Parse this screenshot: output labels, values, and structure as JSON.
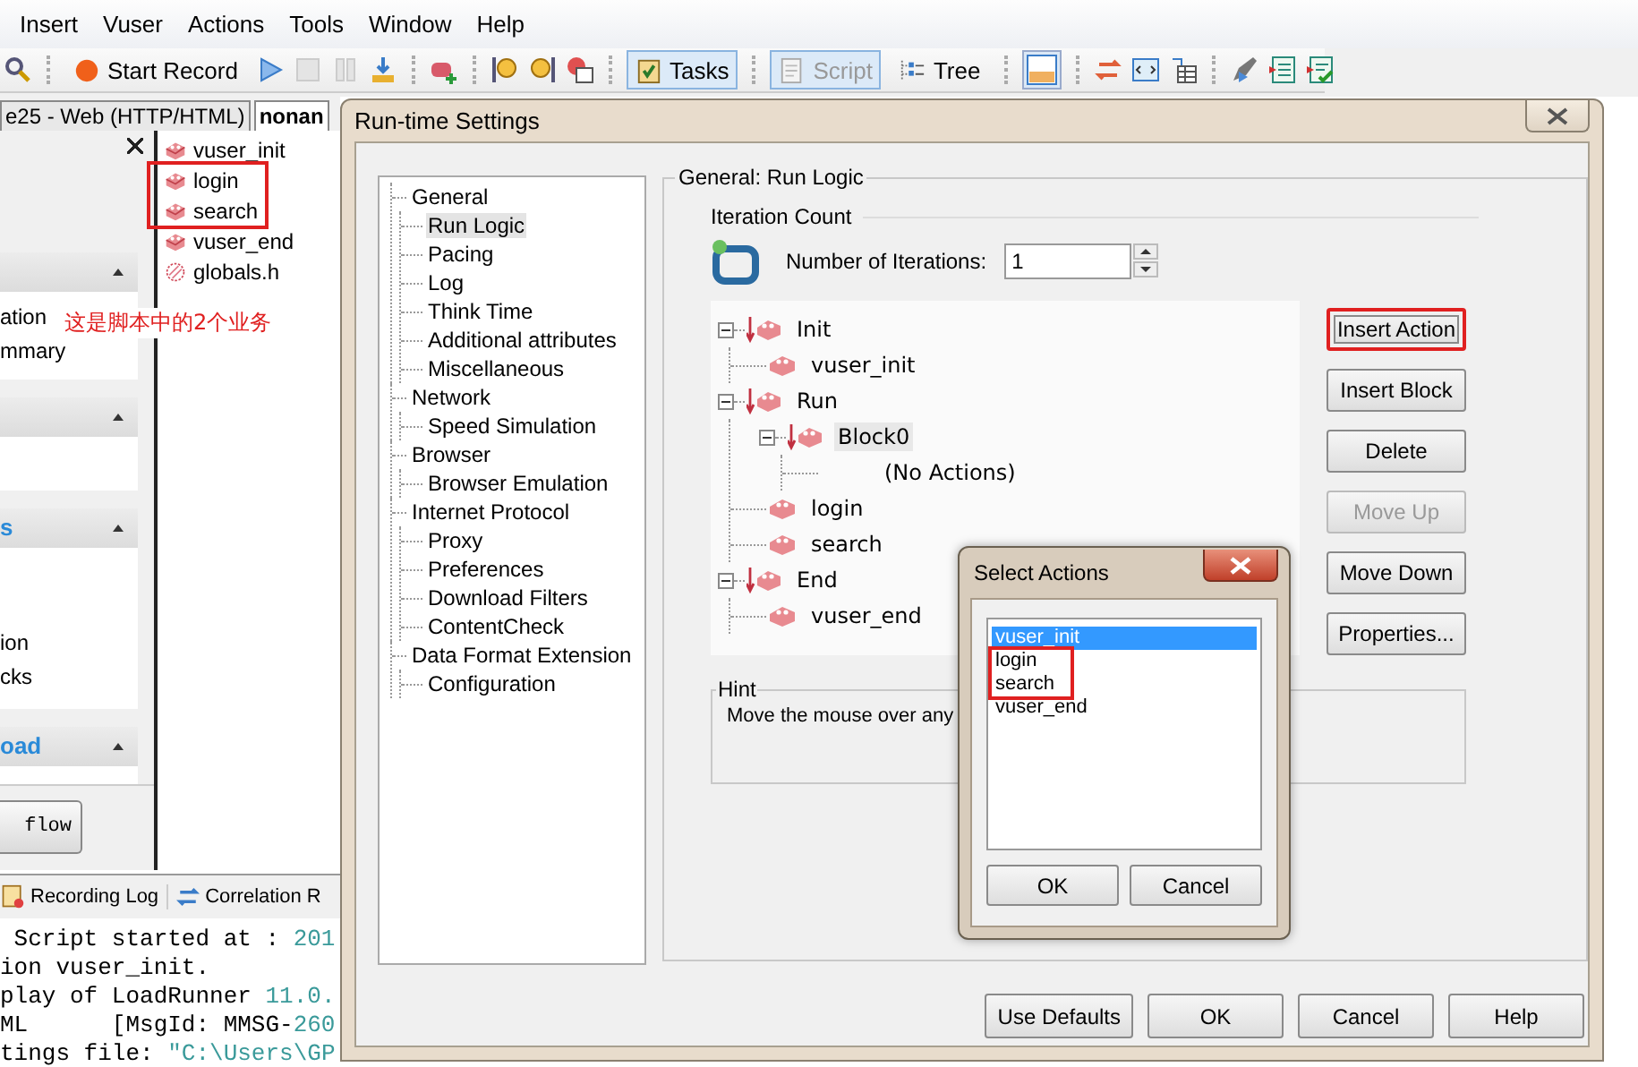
{
  "menu": [
    "Insert",
    "Vuser",
    "Actions",
    "Tools",
    "Window",
    "Help"
  ],
  "toolbar_buttons": [
    {
      "label": "Start Record",
      "selected": false,
      "disabled": false
    },
    {
      "label": "Tasks",
      "selected": true,
      "disabled": false
    },
    {
      "label": "Script",
      "selected": true,
      "disabled": true
    },
    {
      "label": "Tree",
      "selected": false,
      "disabled": false
    }
  ],
  "doc_tabs": [
    {
      "label": "e25 - Web (HTTP/HTML)",
      "selected": false
    },
    {
      "label": "nonan",
      "selected": true
    }
  ],
  "left_panel": {
    "sections": [
      {
        "expanded": true,
        "items": [
          "ation",
          "mmary"
        ]
      },
      {
        "expanded": true
      },
      {
        "title": "s",
        "expanded": true,
        "items": [
          "ion",
          "cks"
        ]
      },
      {
        "title": "oad",
        "expanded": true
      }
    ],
    "button": "flow"
  },
  "annotation_note": "这是脚本中的2个业务",
  "files": [
    {
      "name": "vuser_init",
      "kind": "action",
      "marked": false
    },
    {
      "name": "login",
      "kind": "action",
      "marked": true
    },
    {
      "name": "search",
      "kind": "action",
      "marked": true
    },
    {
      "name": "vuser_end",
      "kind": "action",
      "marked": false
    },
    {
      "name": "globals.h",
      "kind": "header",
      "marked": false
    }
  ],
  "output_tabs": [
    "Recording Log",
    "Correlation R"
  ],
  "log_lines": [
    [
      {
        "text": " Script started at : ",
        "kind": "plain"
      },
      {
        "text": "201",
        "kind": "literal"
      }
    ],
    [
      {
        "text": "ion vuser_init.",
        "kind": "plain"
      }
    ],
    [
      {
        "text": "play of LoadRunner ",
        "kind": "plain"
      },
      {
        "text": "11.0.",
        "kind": "literal"
      }
    ],
    [
      {
        "text": "ML      [MsgId: MMSG-",
        "kind": "plain"
      },
      {
        "text": "260",
        "kind": "literal"
      }
    ],
    [
      {
        "text": "tings file: ",
        "kind": "plain"
      },
      {
        "text": "\"C:\\Users\\GP",
        "kind": "literal"
      }
    ]
  ],
  "dialog": {
    "title": "Run-time Settings",
    "tree": [
      {
        "label": "General",
        "selected": false,
        "children": [
          {
            "label": "Run Logic",
            "selected": true
          },
          {
            "label": "Pacing",
            "selected": false
          },
          {
            "label": "Log",
            "selected": false
          },
          {
            "label": "Think Time",
            "selected": false
          },
          {
            "label": "Additional attributes",
            "selected": false
          },
          {
            "label": "Miscellaneous",
            "selected": false
          }
        ]
      },
      {
        "label": "Network",
        "selected": false,
        "children": [
          {
            "label": "Speed Simulation",
            "selected": false
          }
        ]
      },
      {
        "label": "Browser",
        "selected": false,
        "children": [
          {
            "label": "Browser Emulation",
            "selected": false
          }
        ]
      },
      {
        "label": "Internet Protocol",
        "selected": false,
        "children": [
          {
            "label": "Proxy",
            "selected": false
          },
          {
            "label": "Preferences",
            "selected": false
          },
          {
            "label": "Download Filters",
            "selected": false
          },
          {
            "label": "ContentCheck",
            "selected": false
          }
        ]
      },
      {
        "label": "Data Format Extension",
        "selected": false,
        "children": [
          {
            "label": "Configuration",
            "selected": false
          }
        ]
      }
    ],
    "group_title": "General: Run Logic",
    "iteration_title": "Iteration Count",
    "iterations_label": "Number of Iterations:",
    "iterations_value": "1",
    "actions_tree": [
      {
        "label": "Init",
        "kind": "section",
        "expanded": true,
        "selected": false,
        "children": [
          {
            "label": "vuser_init",
            "kind": "action",
            "selected": false
          }
        ]
      },
      {
        "label": "Run",
        "kind": "section",
        "expanded": true,
        "selected": false,
        "children": [
          {
            "label": "Block0",
            "kind": "section",
            "expanded": true,
            "selected": true,
            "children": [
              {
                "label": "(No Actions)",
                "kind": "placeholder",
                "selected": false
              }
            ]
          },
          {
            "label": "login",
            "kind": "action",
            "selected": false
          },
          {
            "label": "search",
            "kind": "action",
            "selected": false
          }
        ]
      },
      {
        "label": "End",
        "kind": "section",
        "expanded": true,
        "selected": false,
        "children": [
          {
            "label": "vuser_end",
            "kind": "action",
            "selected": false
          }
        ]
      }
    ],
    "side_buttons": [
      {
        "label": "Insert Action",
        "disabled": false,
        "marked": true
      },
      {
        "label": "Insert Block",
        "disabled": false,
        "marked": false
      },
      {
        "label": "Delete",
        "disabled": false,
        "marked": false
      },
      {
        "label": "Move Up",
        "disabled": true,
        "marked": false
      },
      {
        "label": "Move Down",
        "disabled": false,
        "marked": false
      },
      {
        "label": "Properties...",
        "disabled": false,
        "marked": false
      }
    ],
    "hint_title": "Hint",
    "hint_text": "Move the mouse over any",
    "footer_buttons": [
      "Use Defaults",
      "OK",
      "Cancel",
      "Help"
    ]
  },
  "select_dialog": {
    "title": "Select Actions",
    "items": [
      {
        "label": "vuser_init",
        "selected": true,
        "marked": false
      },
      {
        "label": "login",
        "selected": false,
        "marked": true
      },
      {
        "label": "search",
        "selected": false,
        "marked": true
      },
      {
        "label": "vuser_end",
        "selected": false,
        "marked": false
      }
    ],
    "buttons": [
      "OK",
      "Cancel"
    ]
  }
}
